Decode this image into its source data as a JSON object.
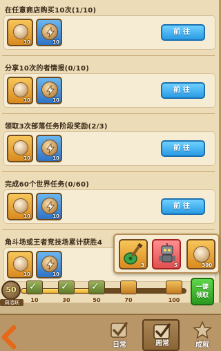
{
  "tasks": [
    {
      "title": "在任意商店购买10次(1/10)",
      "button": "前往",
      "rewards": [
        {
          "type": "coin",
          "qty": "10"
        },
        {
          "type": "badge",
          "qty": "10"
        }
      ]
    },
    {
      "title": "分享10次的者情报(0/10)",
      "button": "前往",
      "rewards": [
        {
          "type": "coin",
          "qty": "10"
        },
        {
          "type": "badge",
          "qty": "10"
        }
      ]
    },
    {
      "title": "领取3次部落任务阶段奖励(2/3)",
      "button": "前往",
      "rewards": [
        {
          "type": "coin",
          "qty": "10"
        },
        {
          "type": "badge",
          "qty": "10"
        }
      ]
    },
    {
      "title": "完成60个世界任务(0/60)",
      "button": "前往",
      "rewards": [
        {
          "type": "coin",
          "qty": "10"
        },
        {
          "type": "badge",
          "qty": "10"
        }
      ]
    },
    {
      "title": "角斗场或王者竞技场累计获胜4",
      "button": "",
      "rewards": [
        {
          "type": "coin",
          "qty": "10"
        },
        {
          "type": "badge",
          "qty": "10"
        }
      ]
    }
  ],
  "popup": {
    "items": [
      {
        "type": "guitar",
        "qty": "3"
      },
      {
        "type": "robot",
        "qty": "5"
      },
      {
        "type": "coin",
        "qty": "300"
      }
    ]
  },
  "progress": {
    "active_value": "50",
    "active_label": "周活跃",
    "fill_fraction": 0.42,
    "milestones": [
      {
        "value": "10",
        "claimed": true
      },
      {
        "value": "30",
        "claimed": true
      },
      {
        "value": "50",
        "claimed": true
      },
      {
        "value": "70",
        "claimed": false
      },
      {
        "value": "100",
        "claimed": false
      }
    ],
    "claim_label_1": "一键",
    "claim_label_2": "领取"
  },
  "tabs": [
    {
      "label": "日常",
      "icon": "check-seal-icon",
      "active": false
    },
    {
      "label": "周常",
      "icon": "check-seal-icon",
      "active": true
    },
    {
      "label": "成就",
      "icon": "star-trophy-icon",
      "active": false
    }
  ],
  "colors": {
    "go_button": "#2a9be4",
    "claim_button": "#2a9a1f",
    "panel": "#ecdcb8"
  }
}
